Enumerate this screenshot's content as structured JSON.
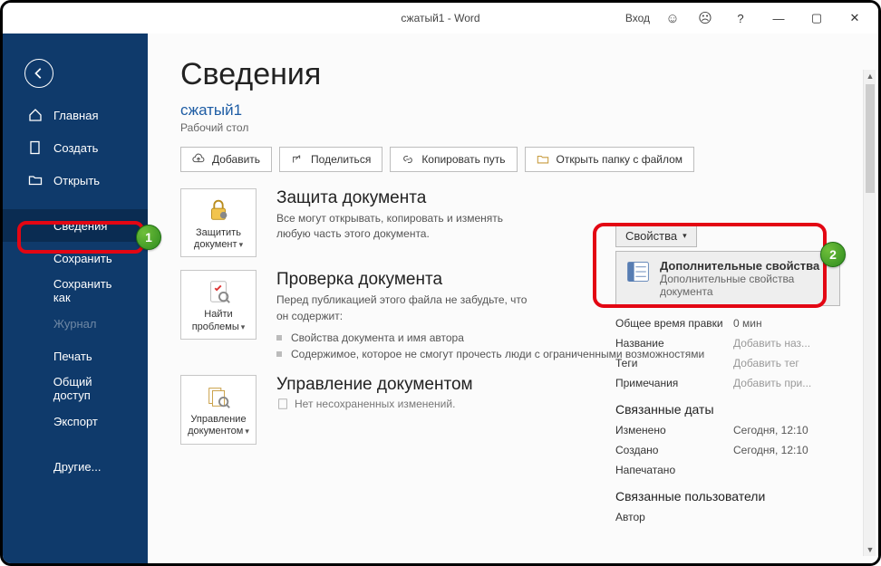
{
  "titlebar": {
    "title": "сжатый1  -  Word",
    "login": "Вход"
  },
  "sidebar": {
    "items": [
      {
        "label": "Главная"
      },
      {
        "label": "Создать"
      },
      {
        "label": "Открыть"
      },
      {
        "label": "Сведения"
      },
      {
        "label": "Сохранить"
      },
      {
        "label": "Сохранить как"
      },
      {
        "label": "Журнал"
      },
      {
        "label": "Печать"
      },
      {
        "label": "Общий доступ"
      },
      {
        "label": "Экспорт"
      },
      {
        "label": "Другие..."
      }
    ]
  },
  "header": {
    "h1": "Сведения",
    "docname": "сжатый1",
    "docloc": "Рабочий стол"
  },
  "toolbar": {
    "upload": "Добавить",
    "share": "Поделиться",
    "copypath": "Копировать путь",
    "openfolder": "Открыть папку с файлом"
  },
  "sections": {
    "protect": {
      "button": "Защитить документ",
      "title": "Защита документа",
      "body": "Все могут открывать, копировать и изменять любую часть этого документа."
    },
    "inspect": {
      "button": "Найти проблемы",
      "title": "Проверка документа",
      "body": "Перед публикацией этого файла не забудьте, что он содержит:",
      "bullets": [
        "Свойства документа и имя автора",
        "Содержимое, которое не смогут прочесть люди с ограниченными возможностями"
      ]
    },
    "manage": {
      "button": "Управление документом",
      "title": "Управление документом",
      "body": "Нет несохраненных изменений."
    }
  },
  "props": {
    "button": "Свойства",
    "advanced": {
      "title": "Дополнительные свойства",
      "sub": "Дополнительные свойства документа"
    },
    "rows": [
      {
        "k": "Общее время правки",
        "v": "0 мин"
      },
      {
        "k": "Название",
        "ph": "Добавить наз..."
      },
      {
        "k": "Теги",
        "ph": "Добавить тег"
      },
      {
        "k": "Примечания",
        "ph": "Добавить при..."
      }
    ],
    "dates_h": "Связанные даты",
    "dates": [
      {
        "k": "Изменено",
        "v": "Сегодня, 12:10"
      },
      {
        "k": "Создано",
        "v": "Сегодня, 12:10"
      },
      {
        "k": "Напечатано",
        "v": ""
      }
    ],
    "users_h": "Связанные пользователи",
    "users": [
      {
        "k": "Автор",
        "v": ""
      }
    ]
  },
  "badges": {
    "one": "1",
    "two": "2"
  }
}
